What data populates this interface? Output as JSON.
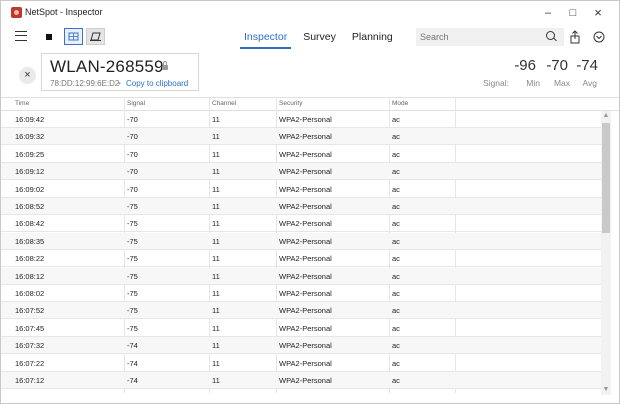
{
  "window": {
    "title": "NetSpot - Inspector",
    "controls": {
      "minimize": "–",
      "maximize": "□",
      "close": "×"
    }
  },
  "toolbar": {
    "tabs": [
      {
        "label": "Inspector",
        "active": true
      },
      {
        "label": "Survey",
        "active": false
      },
      {
        "label": "Planning",
        "active": false
      }
    ],
    "search": {
      "placeholder": "Search"
    },
    "icons": [
      "hamburger-icon",
      "stop-icon",
      "table-view-icon",
      "chart-view-icon",
      "search-icon",
      "share-icon",
      "more-icon"
    ]
  },
  "network": {
    "ssid": "WLAN-268559",
    "mac": "78:DD:12:99:6E:D2",
    "separator": "•",
    "copy_label": "Copy to clipboard",
    "close_label": "×"
  },
  "signal": {
    "label": "Signal:",
    "min_value": "-96",
    "max_value": "-70",
    "avg_value": "-74",
    "min_label": "Min",
    "max_label": "Max",
    "avg_label": "Avg"
  },
  "table": {
    "columns": [
      "Time",
      "Signal",
      "Channel",
      "Security",
      "Mode"
    ],
    "rows": [
      [
        "16:09:42",
        "-70",
        "11",
        "WPA2-Personal",
        "ac"
      ],
      [
        "16:09:32",
        "-70",
        "11",
        "WPA2-Personal",
        "ac"
      ],
      [
        "16:09:25",
        "-70",
        "11",
        "WPA2-Personal",
        "ac"
      ],
      [
        "16:09:12",
        "-70",
        "11",
        "WPA2-Personal",
        "ac"
      ],
      [
        "16:09:02",
        "-70",
        "11",
        "WPA2-Personal",
        "ac"
      ],
      [
        "16:08:52",
        "-75",
        "11",
        "WPA2-Personal",
        "ac"
      ],
      [
        "16:08:42",
        "-75",
        "11",
        "WPA2-Personal",
        "ac"
      ],
      [
        "16:08:35",
        "-75",
        "11",
        "WPA2-Personal",
        "ac"
      ],
      [
        "16:08:22",
        "-75",
        "11",
        "WPA2-Personal",
        "ac"
      ],
      [
        "16:08:12",
        "-75",
        "11",
        "WPA2-Personal",
        "ac"
      ],
      [
        "16:08:02",
        "-75",
        "11",
        "WPA2-Personal",
        "ac"
      ],
      [
        "16:07:52",
        "-75",
        "11",
        "WPA2-Personal",
        "ac"
      ],
      [
        "16:07:45",
        "-75",
        "11",
        "WPA2-Personal",
        "ac"
      ],
      [
        "16:07:32",
        "-74",
        "11",
        "WPA2-Personal",
        "ac"
      ],
      [
        "16:07:22",
        "-74",
        "11",
        "WPA2-Personal",
        "ac"
      ],
      [
        "16:07:12",
        "-74",
        "11",
        "WPA2-Personal",
        "ac"
      ]
    ]
  },
  "colors": {
    "accent": "#2a70c8",
    "app_icon": "#c0392b"
  }
}
